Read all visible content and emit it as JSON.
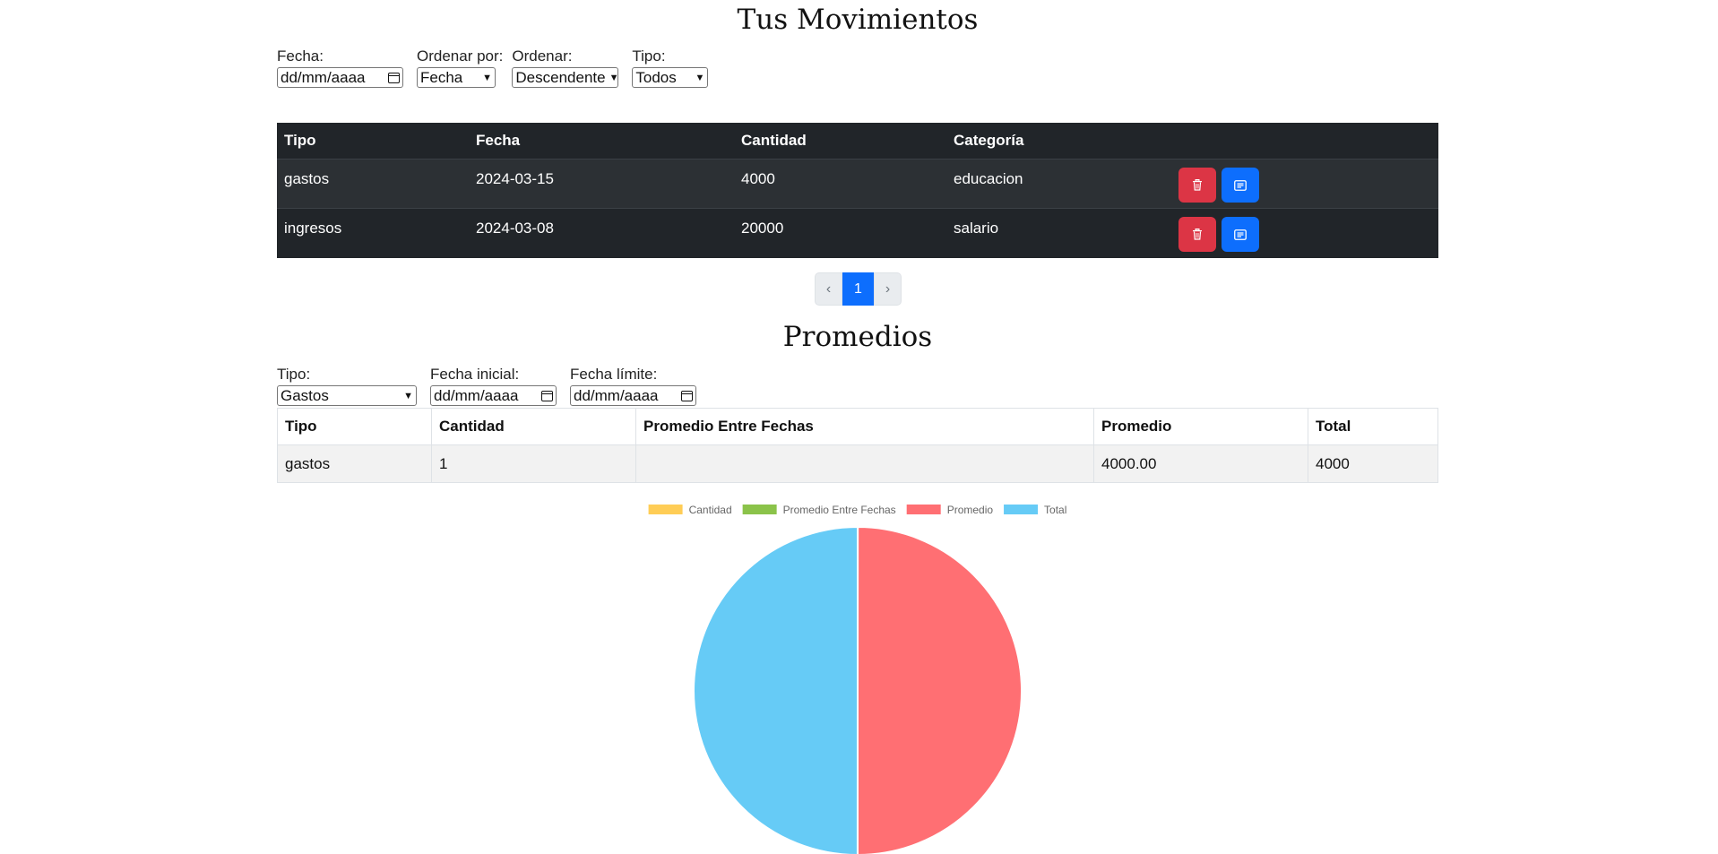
{
  "movements": {
    "title": "Tus Movimientos",
    "filters": {
      "fecha_label": "Fecha:",
      "fecha_placeholder": "dd/mm/aaaa",
      "ordenar_por_label": "Ordenar por:",
      "ordenar_por_value": "Fecha",
      "ordenar_label": "Ordenar:",
      "ordenar_value": "Descendente",
      "tipo_label": "Tipo:",
      "tipo_value": "Todos"
    },
    "columns": [
      "Tipo",
      "Fecha",
      "Cantidad",
      "Categoría"
    ],
    "rows": [
      {
        "tipo": "gastos",
        "fecha": "2024-03-15",
        "cantidad": "4000",
        "categoria": "educacion"
      },
      {
        "tipo": "ingresos",
        "fecha": "2024-03-08",
        "cantidad": "20000",
        "categoria": "salario"
      }
    ],
    "delete_icon": "trash-icon",
    "edit_icon": "edit-icon"
  },
  "pagination": {
    "prev": "‹",
    "current": "1",
    "next": "›"
  },
  "averages": {
    "title": "Promedios",
    "filters": {
      "tipo_label": "Tipo:",
      "tipo_value": "Gastos",
      "fecha_inicial_label": "Fecha inicial:",
      "fecha_inicial_placeholder": "dd/mm/aaaa",
      "fecha_limite_label": "Fecha límite:",
      "fecha_limite_placeholder": "dd/mm/aaaa"
    },
    "columns": [
      "Tipo",
      "Cantidad",
      "Promedio Entre Fechas",
      "Promedio",
      "Total"
    ],
    "rows": [
      {
        "tipo": "gastos",
        "cantidad": "1",
        "promedio_entre_fechas": "",
        "promedio": "4000.00",
        "total": "4000"
      }
    ]
  },
  "chart_data": {
    "type": "pie",
    "categories": [
      "Cantidad",
      "Promedio Entre Fechas",
      "Promedio",
      "Total"
    ],
    "values": [
      1,
      0,
      4000,
      4000
    ],
    "colors": [
      "#ffcd56",
      "#8bc34a",
      "#ff6f73",
      "#66cbf6"
    ],
    "legend": "top"
  }
}
